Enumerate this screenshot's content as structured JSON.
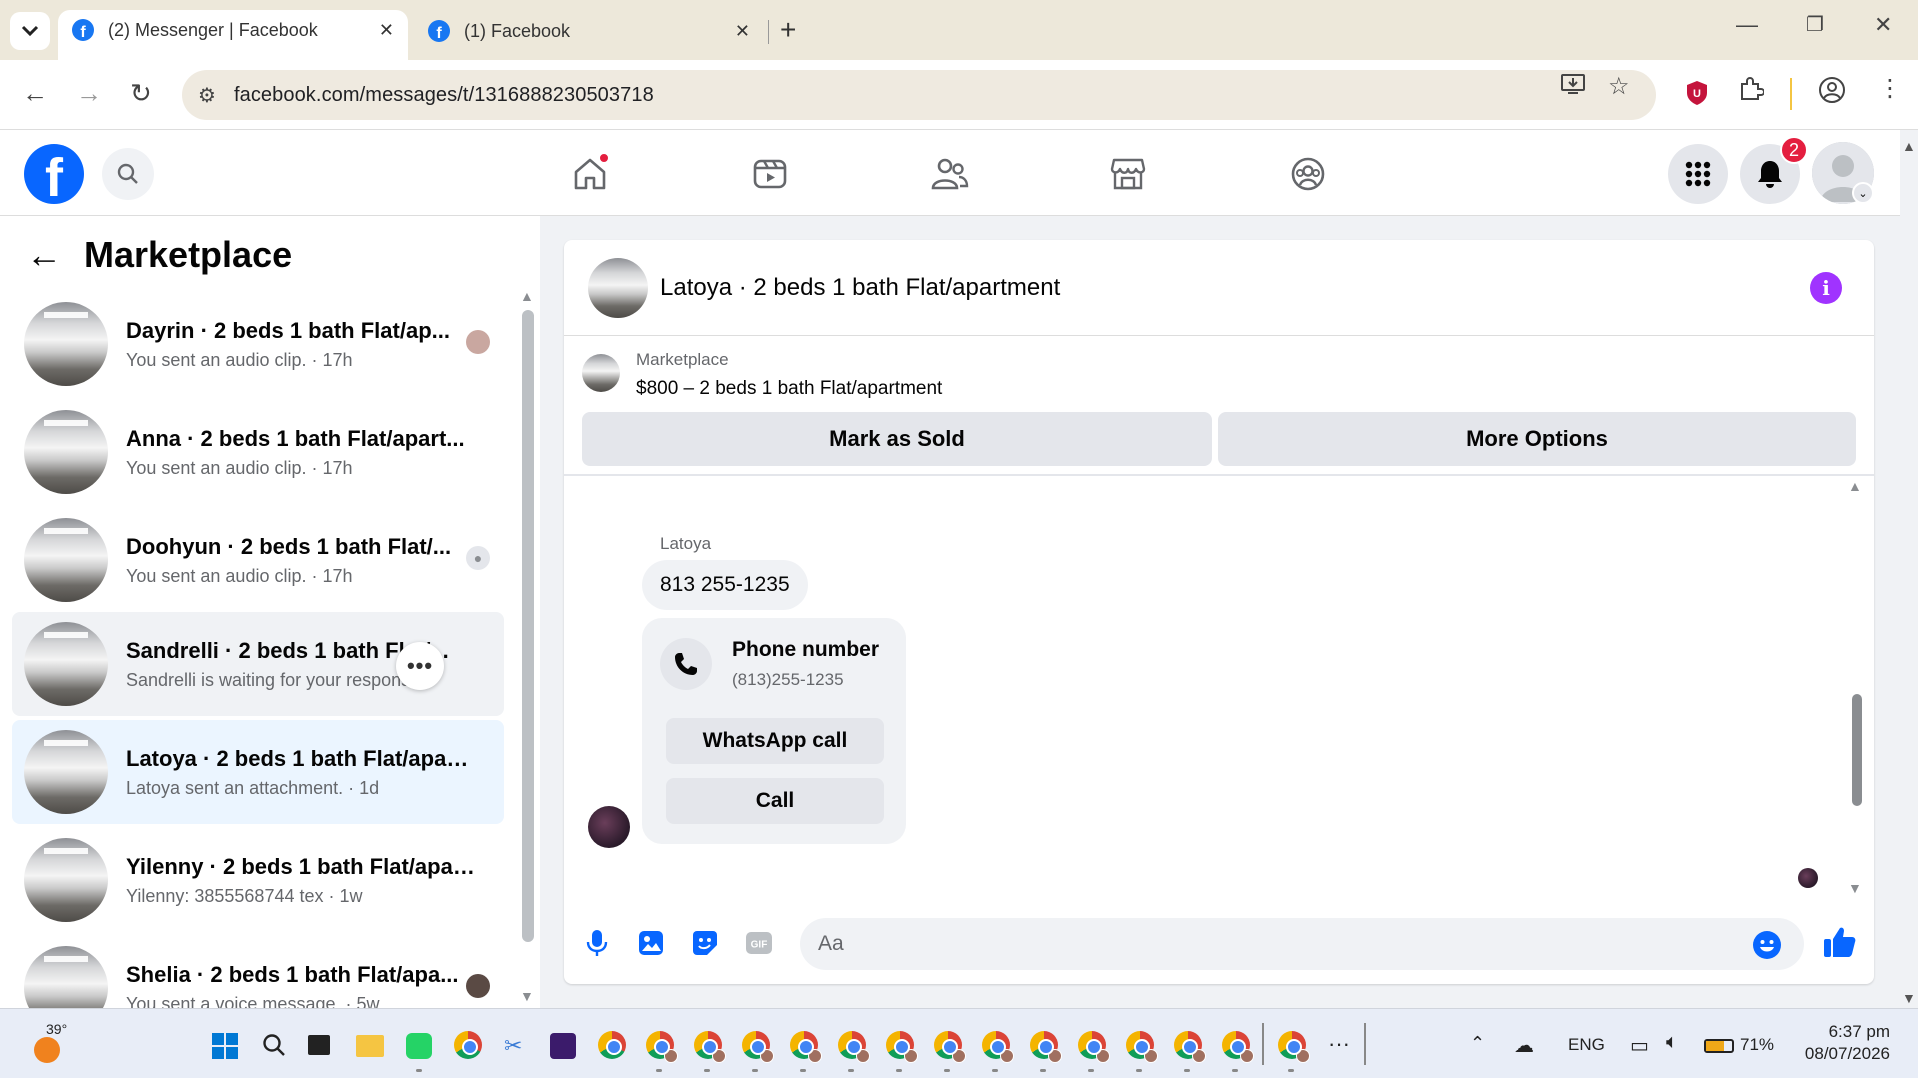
{
  "browser": {
    "tabs": [
      {
        "title": "(2) Messenger | Facebook",
        "active": true
      },
      {
        "title": "(1) Facebook",
        "active": false
      }
    ],
    "url": "facebook.com/messages/t/1316888230503718"
  },
  "fb": {
    "notification_count": "2",
    "nav_icons": [
      "home-icon",
      "video-icon",
      "friends-icon",
      "marketplace-icon",
      "groups-icon"
    ]
  },
  "sidebar": {
    "title": "Marketplace",
    "conversations": [
      {
        "name": "Dayrin · 2 beds 1 bath Flat/ap...",
        "sub": "You sent an audio clip. · 17h",
        "state": "normal"
      },
      {
        "name": "Anna · 2 beds 1 bath Flat/apart...",
        "sub": "You sent an audio clip. · 17h",
        "state": "normal"
      },
      {
        "name": "Doohyun · 2 beds 1 bath Flat/...",
        "sub": "You sent an audio clip. · 17h",
        "state": "normal"
      },
      {
        "name": "Sandrelli · 2 beds 1 bath Flat/...",
        "sub": "Sandrelli is waiting for your response",
        "state": "hover"
      },
      {
        "name": "Latoya · 2 beds 1 bath Flat/apart...",
        "sub": "Latoya sent an attachment. · 1d",
        "state": "active"
      },
      {
        "name": "Yilenny · 2 beds 1 bath Flat/apar...",
        "sub": "Yilenny: 3855568744 tex · 1w",
        "state": "normal"
      },
      {
        "name": "Shelia · 2 beds 1 bath Flat/apa...",
        "sub": "You sent a voice message. · 5w",
        "state": "normal"
      }
    ]
  },
  "chat": {
    "title": "Latoya · 2 beds 1 bath Flat/apartment",
    "listing_source": "Marketplace",
    "listing_item": "$800 – 2 beds 1 bath Flat/apartment",
    "mark_sold_label": "Mark as Sold",
    "more_options_label": "More Options",
    "sender": "Latoya",
    "message_text": "813 255-1235",
    "card_title": "Phone number",
    "card_number": "(813)255-1235",
    "whatsapp_label": "WhatsApp call",
    "call_label": "Call",
    "composer_placeholder": "Aa"
  },
  "taskbar": {
    "temperature": "39°",
    "language": "ENG",
    "battery": "71%",
    "time": "6:37 pm",
    "date": "08/07/2026"
  }
}
